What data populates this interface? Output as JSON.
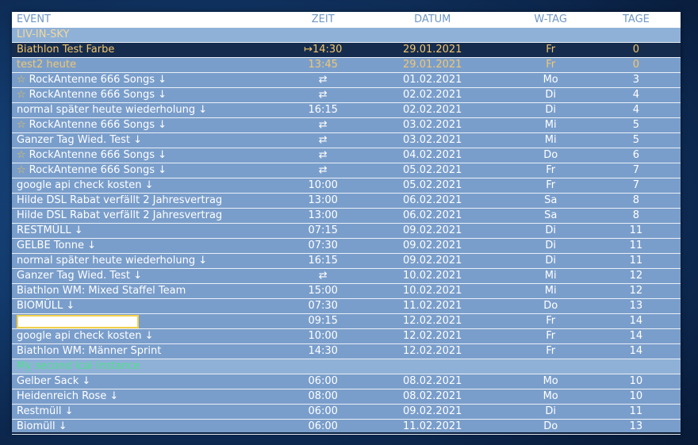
{
  "columns": {
    "event": "EVENT",
    "zeit": "ZEIT",
    "datum": "DATUM",
    "wtag": "W-TAG",
    "tage": "TAGE"
  },
  "group1": {
    "label": "LIV-IN-SKY",
    "color": "#f3d89a"
  },
  "group2": {
    "label": "My second Ical Instance",
    "color": "#4ee08a"
  },
  "rows1": [
    {
      "star": false,
      "event": "Biathlon Test Farbe",
      "zeit": "↦14:30",
      "datum": "29.01.2021",
      "wtag": "Fr",
      "tage": "0",
      "style": "highlight"
    },
    {
      "star": false,
      "event": "test2 heute",
      "zeit": "13:45",
      "datum": "29.01.2021",
      "wtag": "Fr",
      "tage": "0",
      "style": "today"
    },
    {
      "star": true,
      "event": "RockAntenne 666 Songs ↓",
      "zeit": "⇄",
      "datum": "01.02.2021",
      "wtag": "Mo",
      "tage": "3",
      "style": ""
    },
    {
      "star": true,
      "event": "RockAntenne 666 Songs ↓",
      "zeit": "⇄",
      "datum": "02.02.2021",
      "wtag": "Di",
      "tage": "4",
      "style": ""
    },
    {
      "star": false,
      "event": "normal später heute wiederholung ↓",
      "zeit": "16:15",
      "datum": "02.02.2021",
      "wtag": "Di",
      "tage": "4",
      "style": ""
    },
    {
      "star": true,
      "event": "RockAntenne 666 Songs ↓",
      "zeit": "⇄",
      "datum": "03.02.2021",
      "wtag": "Mi",
      "tage": "5",
      "style": ""
    },
    {
      "star": false,
      "event": "Ganzer Tag Wied. Test ↓",
      "zeit": "⇄",
      "datum": "03.02.2021",
      "wtag": "Mi",
      "tage": "5",
      "style": ""
    },
    {
      "star": true,
      "event": "RockAntenne 666 Songs ↓",
      "zeit": "⇄",
      "datum": "04.02.2021",
      "wtag": "Do",
      "tage": "6",
      "style": ""
    },
    {
      "star": true,
      "event": "RockAntenne 666 Songs ↓",
      "zeit": "⇄",
      "datum": "05.02.2021",
      "wtag": "Fr",
      "tage": "7",
      "style": ""
    },
    {
      "star": false,
      "event": "google api check kosten ↓",
      "zeit": "10:00",
      "datum": "05.02.2021",
      "wtag": "Fr",
      "tage": "7",
      "style": ""
    },
    {
      "star": false,
      "event": "Hilde DSL Rabat verfällt 2 Jahresvertrag",
      "zeit": "13:00",
      "datum": "06.02.2021",
      "wtag": "Sa",
      "tage": "8",
      "style": ""
    },
    {
      "star": false,
      "event": "Hilde DSL Rabat verfällt 2 Jahresvertrag",
      "zeit": "13:00",
      "datum": "06.02.2021",
      "wtag": "Sa",
      "tage": "8",
      "style": ""
    },
    {
      "star": false,
      "event": "RESTMÜLL ↓",
      "zeit": "07:15",
      "datum": "09.02.2021",
      "wtag": "Di",
      "tage": "11",
      "style": ""
    },
    {
      "star": false,
      "event": "GELBE Tonne ↓",
      "zeit": "07:30",
      "datum": "09.02.2021",
      "wtag": "Di",
      "tage": "11",
      "style": ""
    },
    {
      "star": false,
      "event": "normal später heute wiederholung ↓",
      "zeit": "16:15",
      "datum": "09.02.2021",
      "wtag": "Di",
      "tage": "11",
      "style": ""
    },
    {
      "star": false,
      "event": "Ganzer Tag Wied. Test ↓",
      "zeit": "⇄",
      "datum": "10.02.2021",
      "wtag": "Mi",
      "tage": "12",
      "style": ""
    },
    {
      "star": false,
      "event": "Biathlon WM: Mixed Staffel Team",
      "zeit": "15:00",
      "datum": "10.02.2021",
      "wtag": "Mi",
      "tage": "12",
      "style": ""
    },
    {
      "star": false,
      "event": "BIOMÜLL ↓",
      "zeit": "07:30",
      "datum": "11.02.2021",
      "wtag": "Do",
      "tage": "13",
      "style": ""
    },
    {
      "star": false,
      "event": "",
      "zeit": "09:15",
      "datum": "12.02.2021",
      "wtag": "Fr",
      "tage": "14",
      "style": "",
      "editbox": true
    },
    {
      "star": false,
      "event": "google api check kosten ↓",
      "zeit": "10:00",
      "datum": "12.02.2021",
      "wtag": "Fr",
      "tage": "14",
      "style": ""
    },
    {
      "star": false,
      "event": "Biathlon WM: Männer Sprint",
      "zeit": "14:30",
      "datum": "12.02.2021",
      "wtag": "Fr",
      "tage": "14",
      "style": ""
    }
  ],
  "rows2": [
    {
      "star": false,
      "event": "Gelber Sack ↓",
      "zeit": "06:00",
      "datum": "08.02.2021",
      "wtag": "Mo",
      "tage": "10",
      "style": ""
    },
    {
      "star": false,
      "event": "Heidenreich Rose ↓",
      "zeit": "08:00",
      "datum": "08.02.2021",
      "wtag": "Mo",
      "tage": "10",
      "style": ""
    },
    {
      "star": false,
      "event": "Restmüll ↓",
      "zeit": "06:00",
      "datum": "09.02.2021",
      "wtag": "Di",
      "tage": "11",
      "style": ""
    },
    {
      "star": false,
      "event": "Biomüll ↓",
      "zeit": "06:00",
      "datum": "11.02.2021",
      "wtag": "Do",
      "tage": "13",
      "style": ""
    }
  ]
}
